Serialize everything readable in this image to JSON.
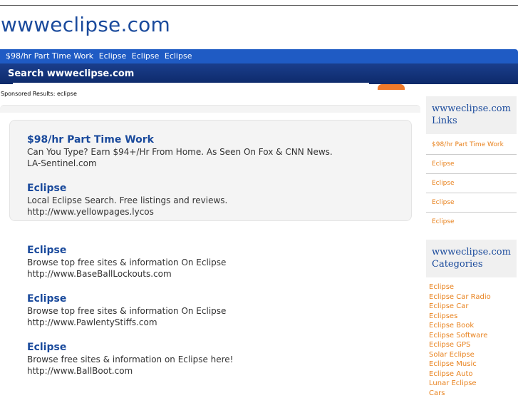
{
  "site": {
    "title": "wwweclipse.com"
  },
  "nav": {
    "items": [
      "$98/hr Part Time Work",
      "Eclipse",
      "Eclipse",
      "Eclipse"
    ]
  },
  "search": {
    "title": "Search wwweclipse.com",
    "value": ""
  },
  "sponsored_label": "Sponsored Results: eclipse",
  "ads": [
    {
      "title": "$98/hr Part Time Work",
      "desc": "Can You Type? Earn $94+/Hr From Home. As Seen On Fox & CNN News.",
      "url": "LA-Sentinel.com"
    },
    {
      "title": "Eclipse",
      "desc": "Local Eclipse Search. Free listings and reviews.",
      "url": "http://www.yellowpages.lycos"
    }
  ],
  "results": [
    {
      "title": "Eclipse",
      "desc": "Browse top free sites & information On Eclipse",
      "url": "http://www.BaseBallLockouts.com"
    },
    {
      "title": "Eclipse",
      "desc": "Browse top free sites & information On Eclipse",
      "url": "http://www.PawlentyStiffs.com"
    },
    {
      "title": "Eclipse",
      "desc": "Browse free sites & information on Eclipse here!",
      "url": "http://www.BallBoot.com"
    }
  ],
  "sidebar": {
    "links_heading": "wwweclipse.com Links",
    "links": [
      "$98/hr Part Time Work",
      "Eclipse",
      "Eclipse",
      "Eclipse",
      "Eclipse"
    ],
    "categories_heading": "wwweclipse.com Categories",
    "categories": [
      "Eclipse",
      "Eclipse Car Radio",
      "Eclipse Car",
      "Eclipses",
      "Eclipse Book",
      "Eclipse Software",
      "Eclipse GPS",
      "Solar Eclipse",
      "Eclipse Music",
      "Eclipse Auto",
      "Lunar Eclipse",
      "Cars"
    ]
  },
  "colors": {
    "brand_blue": "#1f5bc4",
    "link_blue": "#1a4a9c",
    "accent_orange": "#e8821e"
  }
}
